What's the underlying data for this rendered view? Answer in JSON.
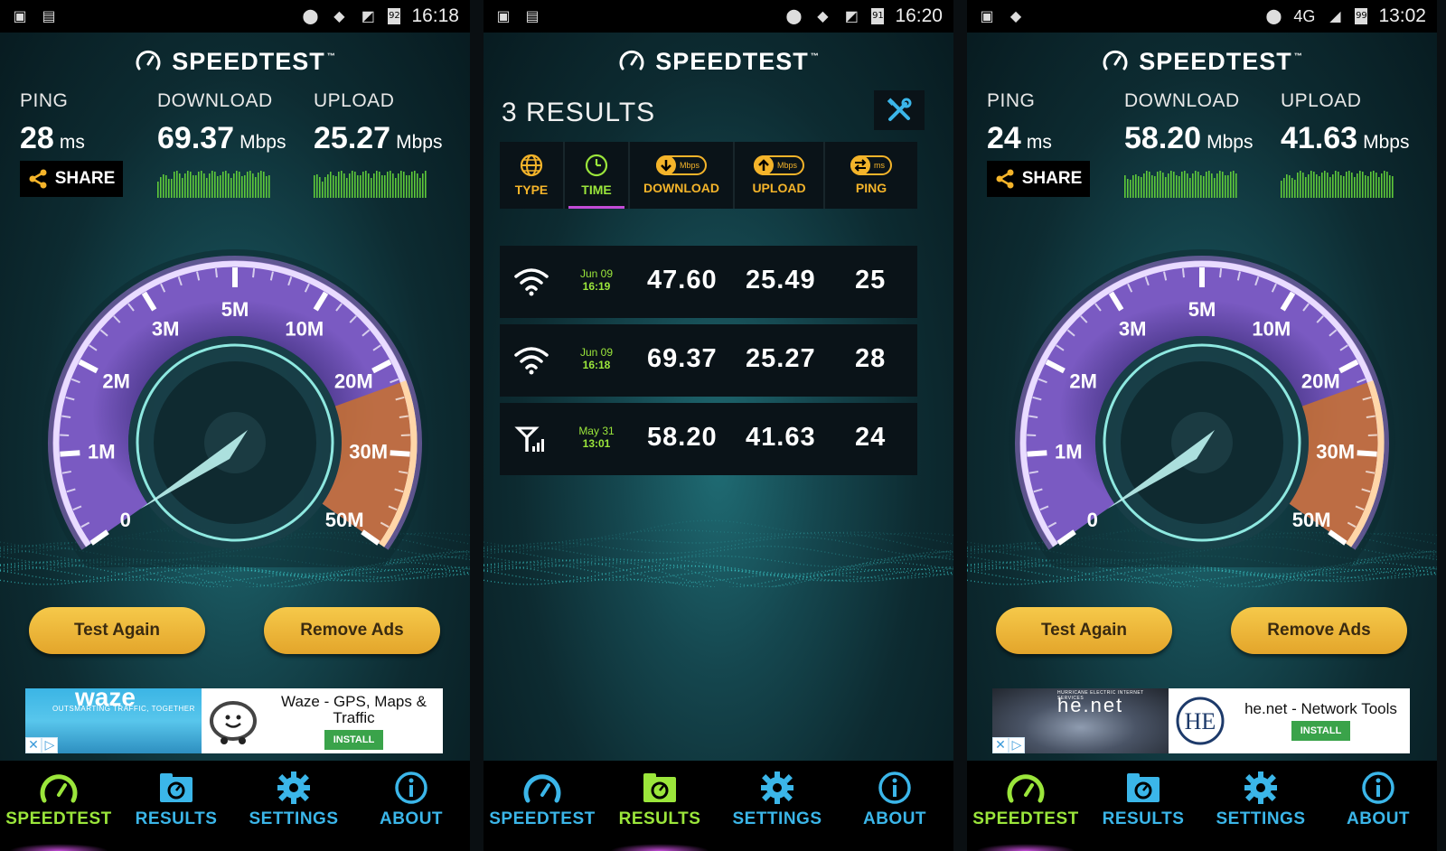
{
  "colors": {
    "accent_orange": "#f4b42a",
    "accent_green": "#9be63b",
    "accent_blue": "#3bb6e9",
    "accent_purple": "#c24bd6",
    "button_gold": "#f6c94a"
  },
  "brand": {
    "name": "SPEEDTEST",
    "tm": "™"
  },
  "labels": {
    "ping": "PING",
    "download": "DOWNLOAD",
    "upload": "UPLOAD",
    "ms": "ms",
    "mbps": "Mbps",
    "share": "SHARE",
    "test_again": "Test Again",
    "remove_ads": "Remove Ads",
    "install": "INSTALL"
  },
  "nav": [
    "SPEEDTEST",
    "RESULTS",
    "SETTINGS",
    "ABOUT"
  ],
  "gauge_ticks": [
    "0",
    "1M",
    "2M",
    "3M",
    "5M",
    "10M",
    "20M",
    "30M",
    "50M"
  ],
  "screen1": {
    "status": {
      "battery": "92",
      "time": "16:18"
    },
    "ping": "28",
    "download": "69.37",
    "upload": "25.27",
    "ad": {
      "title": "waze",
      "tagline": "OUTSMARTING TRAFFIC, TOGETHER",
      "text": "Waze - GPS, Maps & Traffic"
    }
  },
  "screen2": {
    "status": {
      "battery": "91",
      "time": "16:20"
    },
    "results_title": "3 RESULTS",
    "tabs": {
      "type": "TYPE",
      "time": "TIME",
      "download": "DOWNLOAD",
      "upload": "UPLOAD",
      "ping": "PING",
      "mbps": "Mbps",
      "ms": "ms"
    },
    "rows": [
      {
        "kind": "wifi",
        "date": "Jun 09",
        "time": "16:19",
        "download": "47.60",
        "upload": "25.49",
        "ping": "25"
      },
      {
        "kind": "wifi",
        "date": "Jun 09",
        "time": "16:18",
        "download": "69.37",
        "upload": "25.27",
        "ping": "28"
      },
      {
        "kind": "cell",
        "date": "May 31",
        "time": "13:01",
        "download": "58.20",
        "upload": "41.63",
        "ping": "24"
      }
    ]
  },
  "screen3": {
    "status": {
      "battery": "99",
      "time": "13:02",
      "network": "4G"
    },
    "ping": "24",
    "download": "58.20",
    "upload": "41.63",
    "ad": {
      "title": "he.net",
      "tagline": "HURRICANE ELECTRIC INTERNET SERVICES",
      "text": "he.net - Network Tools"
    }
  }
}
